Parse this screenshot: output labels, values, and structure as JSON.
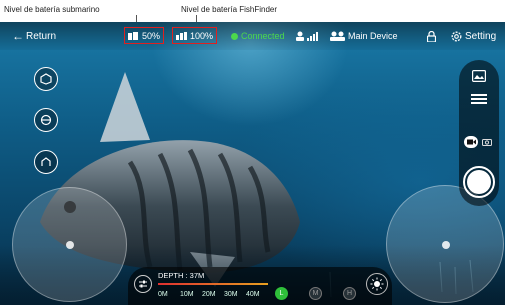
{
  "callouts": {
    "submarine_battery": "Nivel de batería submarino",
    "fishfinder_battery": "Nivel de batería FishFinder"
  },
  "topbar": {
    "return_label": "Return",
    "submarine_battery": "50%",
    "fishfinder_battery": "100%",
    "connection_status": "Connected",
    "device_label": "Main Device",
    "setting_label": "Setting"
  },
  "depth": {
    "label": "DEPTH : 37M",
    "scale": [
      "0M",
      "10M",
      "20M",
      "30M",
      "40M"
    ],
    "light_modes": [
      "L",
      "M",
      "H"
    ],
    "active_mode": "L"
  },
  "colors": {
    "callout_border": "#e02020",
    "connected": "#4cd84c",
    "active_mode": "#2fbf3a"
  },
  "icons": [
    "return-arrow-icon",
    "battery-icon",
    "signal-icon",
    "device-icon",
    "lock-icon",
    "gear-icon",
    "gallery-icon",
    "video-icon",
    "camera-icon",
    "light-icon"
  ]
}
